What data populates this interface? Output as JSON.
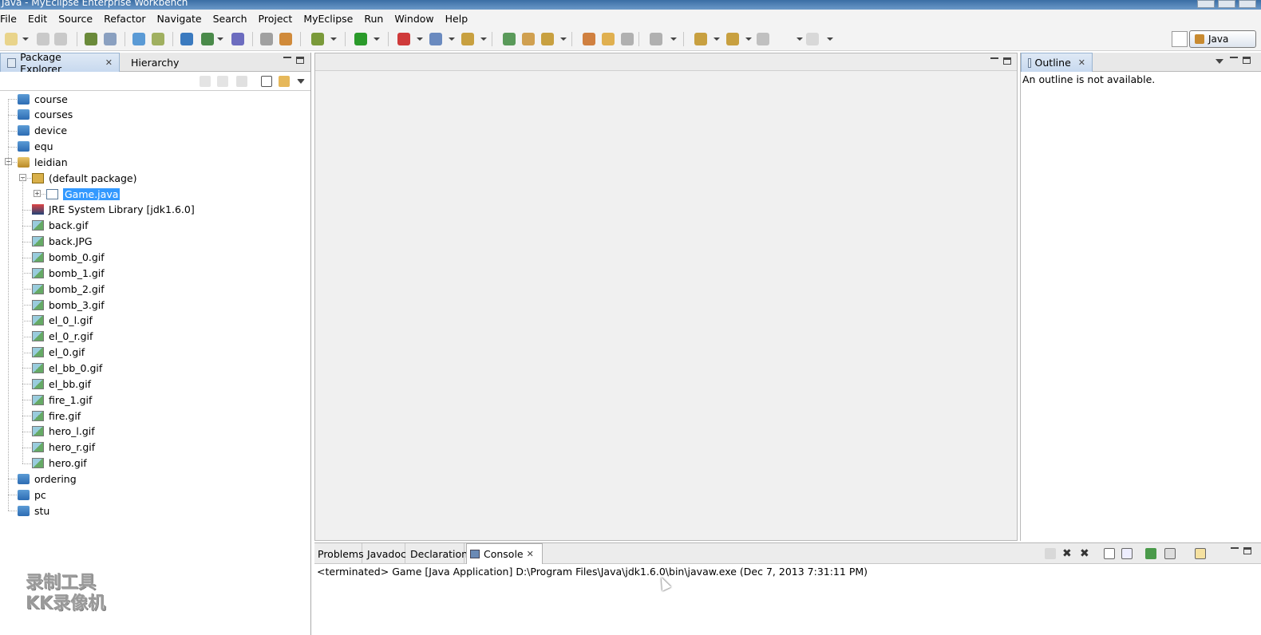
{
  "window": {
    "title": "Java - MyEclipse Enterprise Workbench"
  },
  "menu": [
    "File",
    "Edit",
    "Source",
    "Refactor",
    "Navigate",
    "Search",
    "Project",
    "MyEclipse",
    "Run",
    "Window",
    "Help"
  ],
  "perspective": {
    "label": "Java"
  },
  "left_panel": {
    "tabs": [
      {
        "label": "Package Explorer",
        "active": true
      },
      {
        "label": "Hierarchy",
        "active": false
      }
    ],
    "tree": [
      {
        "label": "course",
        "icon": "folder-icon",
        "level": 0
      },
      {
        "label": "courses",
        "icon": "folder-icon",
        "level": 0
      },
      {
        "label": "device",
        "icon": "folder-icon",
        "level": 0
      },
      {
        "label": "equ",
        "icon": "folder-icon",
        "level": 0
      },
      {
        "label": "leidian",
        "icon": "project-icon",
        "level": 0,
        "expanded": true
      },
      {
        "label": "(default package)",
        "icon": "package-icon",
        "level": 1,
        "expanded": true
      },
      {
        "label": "Game.java",
        "icon": "java-file-icon",
        "level": 2,
        "selected": true
      },
      {
        "label": "JRE System Library [jdk1.6.0]",
        "icon": "library-icon",
        "level": 1
      },
      {
        "label": "back.gif",
        "icon": "image-file-icon",
        "level": 1
      },
      {
        "label": "back.JPG",
        "icon": "image-file-icon",
        "level": 1
      },
      {
        "label": "bomb_0.gif",
        "icon": "image-file-icon",
        "level": 1
      },
      {
        "label": "bomb_1.gif",
        "icon": "image-file-icon",
        "level": 1
      },
      {
        "label": "bomb_2.gif",
        "icon": "image-file-icon",
        "level": 1
      },
      {
        "label": "bomb_3.gif",
        "icon": "image-file-icon",
        "level": 1
      },
      {
        "label": "el_0_l.gif",
        "icon": "image-file-icon",
        "level": 1
      },
      {
        "label": "el_0_r.gif",
        "icon": "image-file-icon",
        "level": 1
      },
      {
        "label": "el_0.gif",
        "icon": "image-file-icon",
        "level": 1
      },
      {
        "label": "el_bb_0.gif",
        "icon": "image-file-icon",
        "level": 1
      },
      {
        "label": "el_bb.gif",
        "icon": "image-file-icon",
        "level": 1
      },
      {
        "label": "fire_1.gif",
        "icon": "image-file-icon",
        "level": 1
      },
      {
        "label": "fire.gif",
        "icon": "image-file-icon",
        "level": 1
      },
      {
        "label": "hero_l.gif",
        "icon": "image-file-icon",
        "level": 1
      },
      {
        "label": "hero_r.gif",
        "icon": "image-file-icon",
        "level": 1
      },
      {
        "label": "hero.gif",
        "icon": "image-file-icon",
        "level": 1
      },
      {
        "label": "ordering",
        "icon": "folder-icon",
        "level": 0
      },
      {
        "label": "pc",
        "icon": "folder-icon",
        "level": 0
      },
      {
        "label": "stu",
        "icon": "folder-icon",
        "level": 0
      }
    ],
    "watermark": {
      "line1": "录制工具",
      "line2": "KK录像机"
    }
  },
  "outline": {
    "tab_label": "Outline",
    "message": "An outline is not available."
  },
  "console": {
    "tabs": [
      {
        "label": "Problems",
        "active": false
      },
      {
        "label": "Javadoc",
        "active": false
      },
      {
        "label": "Declaration",
        "active": false
      },
      {
        "label": "Console",
        "active": true
      }
    ],
    "status": "<terminated> Game [Java Application] D:\\Program Files\\Java\\jdk1.6.0\\bin\\javaw.exe (Dec 7, 2013 7:31:11 PM)"
  },
  "colors": {
    "selection": "#3399ff",
    "chrome": "#f3f3f3",
    "editor_bg": "#f0f0f0"
  }
}
